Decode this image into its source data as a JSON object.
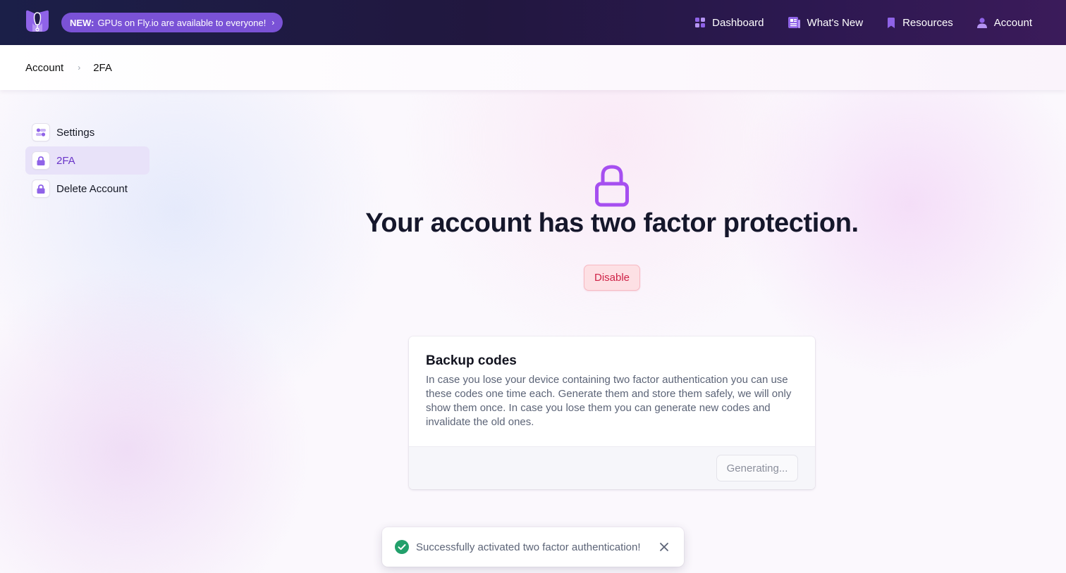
{
  "topbar": {
    "promo": {
      "tag": "NEW:",
      "text": "GPUs on Fly.io are available to everyone!",
      "chevron": "›"
    },
    "nav": [
      {
        "label": "Dashboard",
        "icon": "dashboard-grid-icon"
      },
      {
        "label": "What's New",
        "icon": "newspaper-icon"
      },
      {
        "label": "Resources",
        "icon": "bookmark-icon"
      },
      {
        "label": "Account",
        "icon": "user-icon"
      }
    ]
  },
  "breadcrumb": {
    "items": [
      "Account",
      "2FA"
    ],
    "separator": "›"
  },
  "sidebar": {
    "items": [
      {
        "label": "Settings",
        "icon": "settings-toggle-icon",
        "active": false
      },
      {
        "label": "2FA",
        "icon": "lock-icon",
        "active": true
      },
      {
        "label": "Delete Account",
        "icon": "lock-icon",
        "active": false
      }
    ]
  },
  "main": {
    "headline": "Your account has two factor protection.",
    "disable_label": "Disable"
  },
  "backup": {
    "title": "Backup codes",
    "description": "In case you lose your device containing two factor authentication you can use these codes one time each. Generate them and store them safely, we will only show them once. In case you lose them you can generate new codes and invalidate the old ones.",
    "button_label": "Generating..."
  },
  "toast": {
    "message": "Successfully activated two factor authentication!",
    "status": "success"
  },
  "colors": {
    "accent": "#7a52d6",
    "active_text": "#6a35c9",
    "danger": "#cf2347",
    "success": "#22a06b"
  }
}
